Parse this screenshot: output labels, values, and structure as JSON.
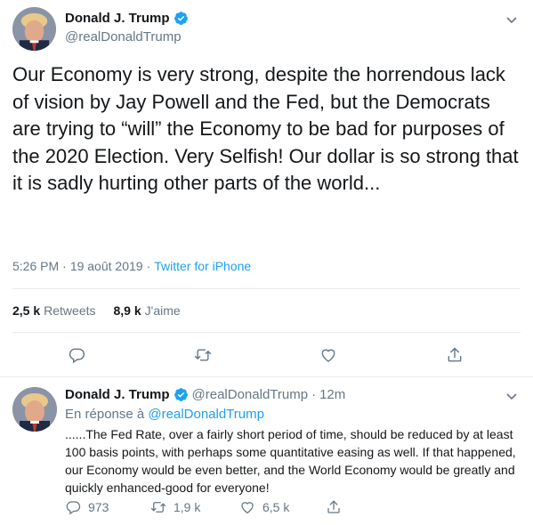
{
  "main_tweet": {
    "author": {
      "display_name": "Donald J. Trump",
      "handle": "@realDonaldTrump",
      "verified": true
    },
    "text": "Our Economy is very strong, despite the horrendous lack of vision by Jay Powell and the Fed, but the Democrats are trying to “will” the Economy to be bad for purposes of the 2020 Election.  Very Selfish! Our dollar is so strong that it is sadly hurting other parts of the world...",
    "time": "5:26 PM",
    "separator1": "·",
    "date": "19 août 2019",
    "separator2": "·",
    "source": "Twitter for iPhone",
    "stats": {
      "retweets_count": "2,5 k",
      "retweets_label": "Retweets",
      "likes_count": "8,9 k",
      "likes_label": "J'aime"
    },
    "actions": [
      "reply-icon",
      "retweet-icon",
      "like-icon",
      "share-icon"
    ]
  },
  "reply_tweet": {
    "author": {
      "display_name": "Donald J. Trump",
      "handle": "@realDonaldTrump",
      "verified": true
    },
    "separator": "·",
    "time_ago": "12m",
    "replying_prefix": "En réponse à",
    "replying_to": "@realDonaldTrump",
    "text": "......The Fed Rate, over a fairly short period of time, should be reduced by at least 100 basis points, with perhaps some quantitative easing as well. If that happened, our Economy would be even better, and the World Economy would be greatly and quickly enhanced-good for everyone!",
    "replies": "973",
    "retweets": "1,9 k",
    "likes": "6,5 k"
  },
  "colors": {
    "accent": "#1da1f2",
    "secondary_text": "#657786",
    "divider": "#e6ecf0"
  }
}
